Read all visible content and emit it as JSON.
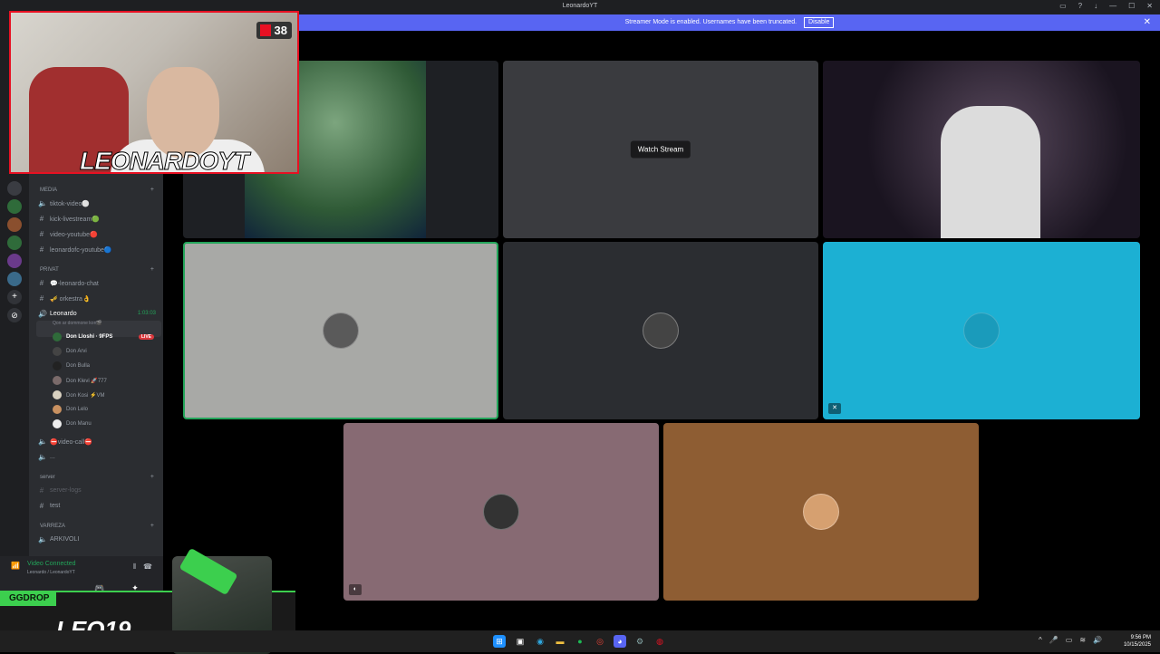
{
  "window": {
    "title": "LeonardoYT",
    "controls": [
      "inbox-icon",
      "help-icon",
      "download-icon",
      "minimize-icon",
      "maximize-icon",
      "close-icon"
    ]
  },
  "banner": {
    "text": "Streamer Mode is enabled. Usernames have been truncated.",
    "button": "Disable",
    "close": "✕"
  },
  "sidebar": {
    "categories": [
      {
        "name": "MEDIA",
        "channels": [
          "tiktok-video⚪",
          "kick-livestream🟢",
          "video-youtube🔴",
          "leonardofc-youtube🔵"
        ]
      },
      {
        "name": "PRIVAT",
        "channels": [
          "💬-leonardo-chat",
          "🎺 orkestra👌"
        ]
      }
    ],
    "voice_channel": {
      "name": "Leonardo",
      "time": "1:03:03",
      "status": "Qon ar dommone kon🎬"
    },
    "users": [
      {
        "name": "Don Lloshi · 9FPS",
        "live": "LIVE"
      },
      {
        "name": "Don Arvi"
      },
      {
        "name": "Don Bulla"
      },
      {
        "name": "Don Klevi 🚀777"
      },
      {
        "name": "Don Kosi ⚡VM"
      },
      {
        "name": "Don Lelo"
      },
      {
        "name": "Don Manu"
      }
    ],
    "after_channels": [
      "⛔video-call⛔",
      "..."
    ],
    "server_cat": "server",
    "server_channels": [
      "server-logs",
      "test"
    ],
    "varreza_cat": "VARREZA",
    "varreza_channels": [
      "ARKIVOLI"
    ],
    "voice_panel": {
      "status": "Video Connected",
      "sub": "Leonardo / LeonardoYT"
    }
  },
  "overlay": {
    "kill_count": "38",
    "brand": "LEONARDOYT",
    "sponsor": "GGDROP",
    "code": "LEO19"
  },
  "stage": {
    "watch_stream": "Watch Stream",
    "tiles": [
      {
        "color": "#2e5f3a"
      },
      {
        "color": "#2c2d31"
      },
      {
        "color": "#1a1420"
      },
      {
        "color": "#a8a9a6"
      },
      {
        "color": "#2b2d31"
      },
      {
        "color": "#1cb0d3"
      },
      {
        "color": "#876a73"
      },
      {
        "color": "#8e5d33"
      }
    ]
  },
  "taskbar": {
    "time": "9:56 PM",
    "date": "10/15/2025"
  }
}
